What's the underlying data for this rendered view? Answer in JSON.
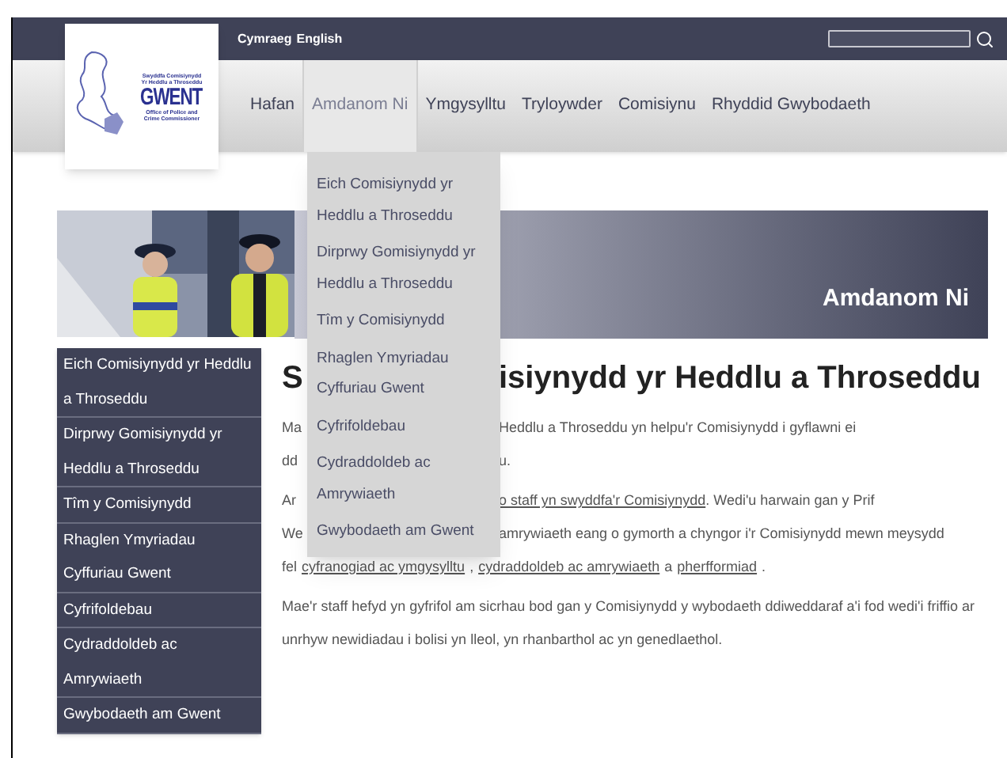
{
  "logo": {
    "line_1": "Swyddfa Comisiynydd",
    "line_2": "Yr Heddlu a Throseddu",
    "name": "GWENT",
    "line_3": "Office of Police and",
    "line_4": "Crime Commissioner"
  },
  "languages": [
    "Cymraeg",
    "English"
  ],
  "nav": [
    {
      "label": "Hafan",
      "selected": false
    },
    {
      "label": "Amdanom Ni",
      "selected": true
    },
    {
      "label": "Ymgysylltu",
      "selected": false
    },
    {
      "label": "Tryloywder",
      "selected": false
    },
    {
      "label": "Comisiynu",
      "selected": false
    },
    {
      "label": "Rhyddid Gwybodaeth",
      "selected": false
    }
  ],
  "dropdown": {
    "expanded": true,
    "items": [
      "Eich Comisiynydd yr Heddlu a Throseddu",
      "Dirprwy Gomisiynydd yr Heddlu a Throseddu",
      "Tîm y Comisiynydd",
      "Rhaglen Ymyriadau Cyffuriau Gwent",
      "Cyfrifoldebau",
      "Cydraddoldeb ac Amrywiaeth",
      "Gwybodaeth am Gwent"
    ]
  },
  "banner": {
    "title": "Amdanom Ni"
  },
  "sidebar": {
    "items": [
      "Eich Comisiynydd yr Heddlu a Throseddu",
      "Dirprwy Gomisiynydd yr Heddlu a Throseddu",
      "Tîm y Comisiynydd",
      "Rhaglen Ymyriadau Cyffuriau Gwent",
      "Cyfrifoldebau",
      "Cydraddoldeb ac Amrywiaeth",
      "Gwybodaeth am Gwent"
    ]
  },
  "heading": {
    "left": "S",
    "right": "isiynydd yr Heddlu a Throseddu"
  },
  "covered_lines": [
    {
      "left": "Ma",
      "parts": [
        {
          "text": "Heddlu a Throseddu yn helpu'r Comisiynydd i gyflawni ei",
          "link": false
        }
      ]
    },
    {
      "left": "dd",
      "parts": [
        {
          "text": "u.",
          "link": false
        }
      ]
    },
    {
      "left": "Ar",
      "parts": [
        {
          "text": "o staff yn swyddfa'r Comisiynydd",
          "link": true
        },
        {
          "text": ". Wedi'u harwain gan y Prif",
          "link": false
        }
      ]
    },
    {
      "left": "We",
      "parts": [
        {
          "text": "amrywiaeth eang o gymorth a chyngor i'r Comisiynydd mewn meysydd",
          "link": false
        }
      ]
    }
  ],
  "full_line": [
    {
      "text": "fel",
      "link": false
    },
    {
      "text": "cyfranogiad ac ymgysylltu",
      "link": true
    },
    {
      "text": ",",
      "link": false
    },
    {
      "text": "cydraddoldeb ac amrywiaeth",
      "link": true
    },
    {
      "text": "a",
      "link": false
    },
    {
      "text": "pherfformiad",
      "link": true
    },
    {
      "text": ".",
      "link": false
    }
  ],
  "paragraph": "Mae'r staff hefyd yn gyfrifol am sicrhau bod gan y Comisiynydd y wybodaeth ddiweddaraf a'i fod wedi'i friffio ar unrhyw newidiadau i bolisi yn lleol, yn rhanbarthol ac yn genedlaethol."
}
